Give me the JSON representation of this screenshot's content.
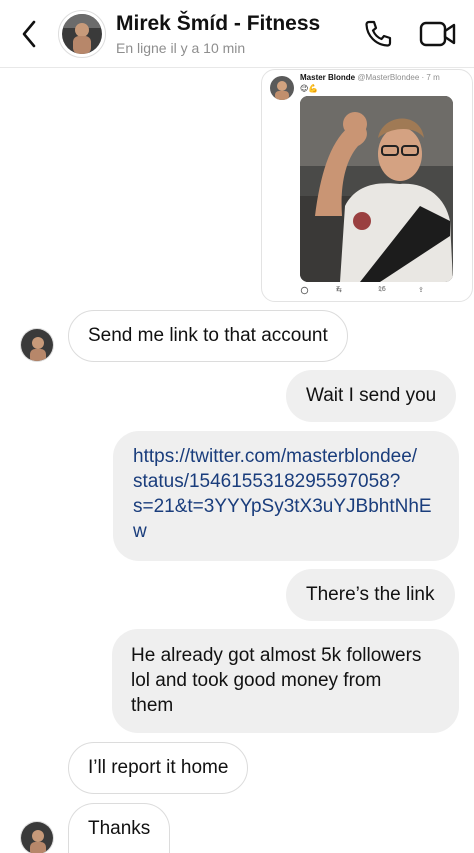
{
  "header": {
    "title": "Mirek Šmíd - Fitness",
    "status": "En ligne il y a 10 min",
    "back_icon": "chevron-left-icon",
    "call_icon": "phone-icon",
    "video_icon": "video-camera-icon"
  },
  "tweet": {
    "author": "Master Blonde",
    "handle": "@MasterBlondee · 7 m",
    "emoji": "😉💪",
    "retweets": "7",
    "likes": "16"
  },
  "messages": [
    {
      "from": "them",
      "text": "Send me link to that account"
    },
    {
      "from": "me",
      "text": "Wait I send you"
    },
    {
      "from": "me",
      "lines": [
        "https://twitter.com/masterblondee/",
        "status/1546155318295597058?",
        "s=21&t=3YYYpSy3tX3uYJBbhtNhE",
        "w"
      ]
    },
    {
      "from": "me",
      "text": "There’s the link"
    },
    {
      "from": "me",
      "lines": [
        "He already got almost 5k followers",
        "lol and took good money from",
        "them"
      ]
    },
    {
      "from": "them",
      "text": "I’ll report it home"
    },
    {
      "from": "them",
      "text": "Thanks"
    }
  ],
  "colors": {
    "sent_bubble": "#efefef",
    "link": "#1a3d7c",
    "muted": "#8e8e8e"
  }
}
